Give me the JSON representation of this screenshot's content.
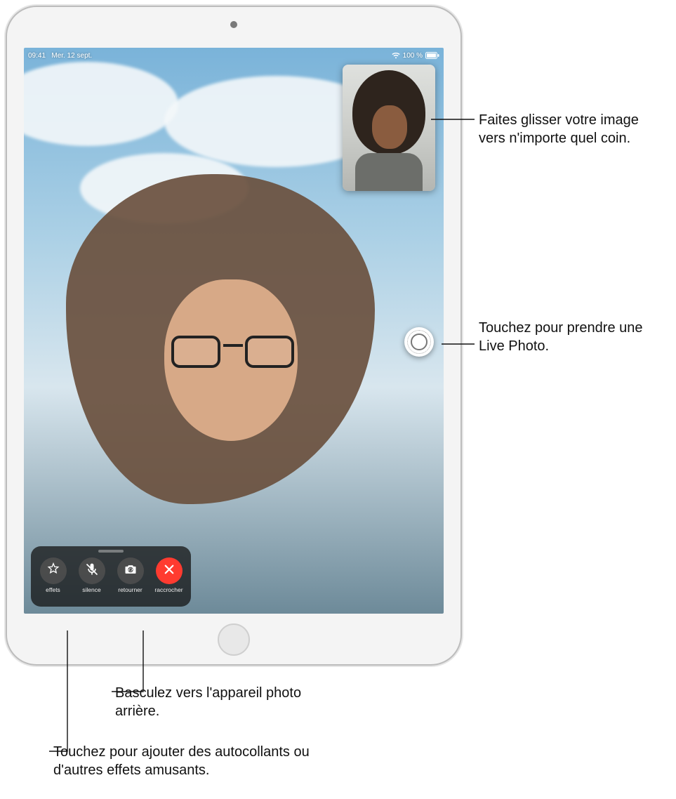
{
  "status_bar": {
    "time": "09:41",
    "date": "Mer. 12 sept.",
    "wifi_icon": "wifi-icon",
    "battery_text": "100 %",
    "battery_icon": "battery-full-icon"
  },
  "pip": {
    "description": "self-camera-preview"
  },
  "live_photo_button": {
    "icon": "live-photo-icon"
  },
  "controls": {
    "effects": {
      "label": "effets",
      "icon": "star-effects-icon"
    },
    "mute": {
      "label": "silence",
      "icon": "mic-off-icon"
    },
    "flip": {
      "label": "retourner",
      "icon": "camera-flip-icon"
    },
    "end": {
      "label": "raccrocher",
      "icon": "close-x-icon"
    }
  },
  "callouts": {
    "pip_drag": "Faites glisser votre image vers n'importe quel coin.",
    "live_photo": "Touchez pour prendre une Live Photo.",
    "flip_camera": "Basculez vers l'appareil photo arrière.",
    "effects": "Touchez pour ajouter des autocollants ou d'autres effets amusants."
  },
  "colors": {
    "end_call": "#ff3b30",
    "panel_bg": "rgba(20,20,20,.75)"
  }
}
